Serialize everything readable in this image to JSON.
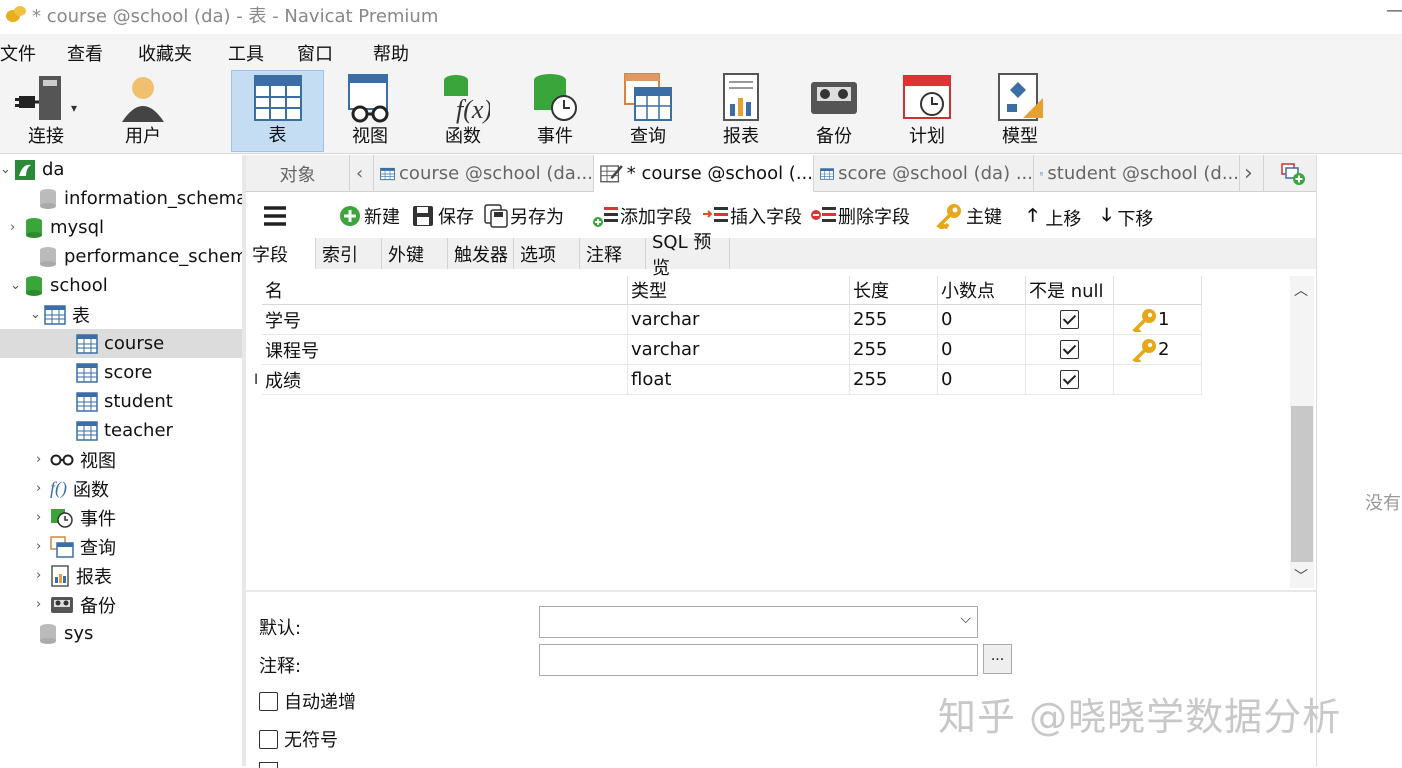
{
  "window": {
    "title": "* course @school (da) - 表 - Navicat Premium",
    "minimize": "—"
  },
  "menu": [
    "文件",
    "查看",
    "收藏夹",
    "工具",
    "窗口",
    "帮助"
  ],
  "toolbar": [
    {
      "label": "连接",
      "icon": "connection-icon"
    },
    {
      "label": "用户",
      "icon": "user-icon"
    },
    {
      "label": "表",
      "icon": "table-icon",
      "active": true
    },
    {
      "label": "视图",
      "icon": "view-icon"
    },
    {
      "label": "函数",
      "icon": "function-icon"
    },
    {
      "label": "事件",
      "icon": "event-icon"
    },
    {
      "label": "查询",
      "icon": "query-icon"
    },
    {
      "label": "报表",
      "icon": "report-icon"
    },
    {
      "label": "备份",
      "icon": "backup-icon"
    },
    {
      "label": "计划",
      "icon": "schedule-icon"
    },
    {
      "label": "模型",
      "icon": "model-icon"
    }
  ],
  "tree": {
    "connection": "da",
    "databases": [
      "information_schema",
      "mysql",
      "performance_schema",
      "school",
      "sys"
    ],
    "school_groups": {
      "tables_label": "表",
      "tables": [
        "course",
        "score",
        "student",
        "teacher"
      ],
      "others": [
        "视图",
        "函数",
        "事件",
        "查询",
        "报表",
        "备份"
      ]
    }
  },
  "tabs": {
    "objects": "对象",
    "items": [
      "course @school (da...",
      "* course @school (...",
      "score @school (da) ...",
      "student @school (d..."
    ]
  },
  "editor_toolbar": {
    "new": "新建",
    "save": "保存",
    "save_as": "另存为",
    "add_field": "添加字段",
    "insert_field": "插入字段",
    "delete_field": "删除字段",
    "primary_key": "主键",
    "move_up": "上移",
    "move_down": "下移"
  },
  "subtabs": [
    "字段",
    "索引",
    "外键",
    "触发器",
    "选项",
    "注释",
    "SQL 预览"
  ],
  "grid": {
    "columns": [
      "名",
      "类型",
      "长度",
      "小数点",
      "不是 null",
      ""
    ],
    "rows": [
      {
        "name": "学号",
        "type": "varchar",
        "length": "255",
        "decimals": "0",
        "not_null": true,
        "key": "1"
      },
      {
        "name": "课程号",
        "type": "varchar",
        "length": "255",
        "decimals": "0",
        "not_null": true,
        "key": "2"
      },
      {
        "name": "成绩",
        "type": "float",
        "length": "255",
        "decimals": "0",
        "not_null": true,
        "key": ""
      }
    ],
    "cursor_glyph": "I"
  },
  "props": {
    "default_label": "默认:",
    "comment_label": "注释:",
    "ellipsis": "...",
    "auto_increment": "自动递增",
    "unsigned": "无符号"
  },
  "right_panel": {
    "text": "没有"
  },
  "watermark": "知乎 @晓晓学数据分析",
  "colors": {
    "accent": "#c4ddf3",
    "db_green": "#3aa53a",
    "key_gold": "#e6a817"
  }
}
